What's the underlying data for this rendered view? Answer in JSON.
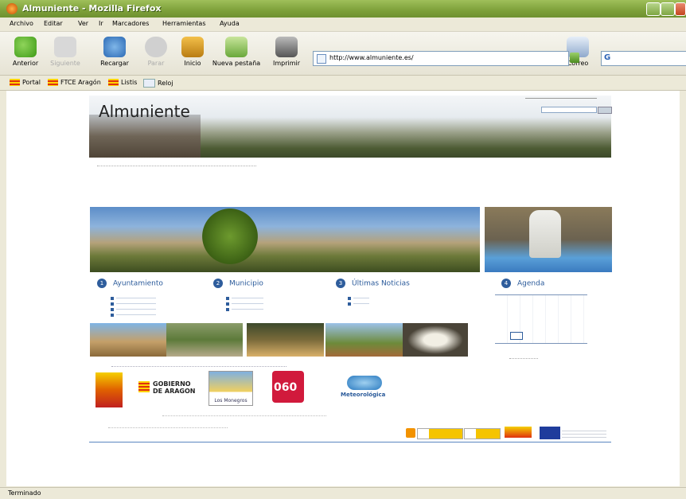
{
  "window": {
    "title": "Almuniente - Mozilla Firefox"
  },
  "menu": [
    "Archivo",
    "Editar",
    "Ver",
    "Ir",
    "Marcadores",
    "Herramientas",
    "Ayuda"
  ],
  "toolbar": {
    "back": "Anterior",
    "forward": "Siguiente",
    "reload": "Recargar",
    "stop": "Parar",
    "home": "Inicio",
    "newtab": "Nueva pestaña",
    "print": "Imprimir",
    "url": "http://www.almuniente.es/",
    "mail": "Correo"
  },
  "bookmarks": [
    "Portal",
    "FTCE Aragón",
    "Listis",
    "Reloj"
  ],
  "site": {
    "title": "Almuniente",
    "sections": [
      {
        "number": "1",
        "label": "Ayuntamiento"
      },
      {
        "number": "2",
        "label": "Municipio"
      },
      {
        "number": "3",
        "label": "Últimas Noticias"
      },
      {
        "number": "4",
        "label": "Agenda"
      }
    ],
    "logos": {
      "gobierno": "GOBIERNO DE ARAGON",
      "monegros": "Los Monegros",
      "tel": "060",
      "meteo": "Meteorológica"
    }
  },
  "status": "Terminado",
  "colors": {
    "titlebar": "#7da03a",
    "accent": "#2e5d9c"
  }
}
